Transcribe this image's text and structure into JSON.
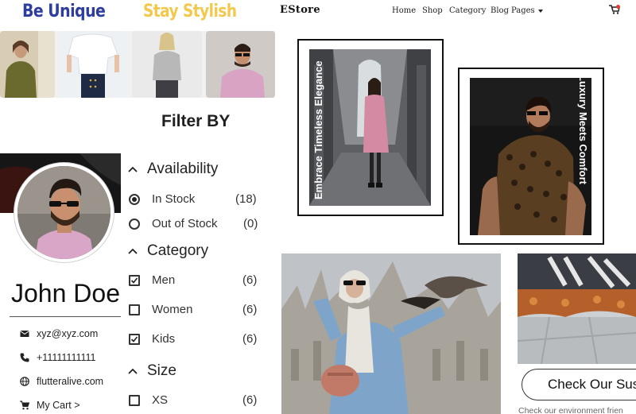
{
  "taglines": {
    "first": "Be Unique",
    "second": "Stay Stylish"
  },
  "header": {
    "brand": "EStore",
    "nav": [
      "Home",
      "Shop",
      "Category",
      "Blog",
      "Pages"
    ]
  },
  "filter": {
    "title": "Filter BY",
    "availability": {
      "title": "Availability",
      "options": [
        {
          "label": "In Stock",
          "count": "(18)",
          "selected": true
        },
        {
          "label": "Out of Stock",
          "count": "(0)",
          "selected": false
        }
      ]
    },
    "category": {
      "title": "Category",
      "options": [
        {
          "label": "Men",
          "count": "(6)",
          "checked": true
        },
        {
          "label": "Women",
          "count": "(6)",
          "checked": false
        },
        {
          "label": "Kids",
          "count": "(6)",
          "checked": true
        }
      ]
    },
    "size": {
      "title": "Size",
      "options": [
        {
          "label": "XS",
          "count": "(6)",
          "checked": false
        }
      ]
    }
  },
  "profile": {
    "name": "John Doe",
    "email": "xyz@xyz.com",
    "phone": "+11111111111",
    "website": "flutteralive.com",
    "cart": "My Cart >"
  },
  "promos": {
    "left_caption": "Embrace Timeless Elegance",
    "right_caption": "Luxury Meets Comfort"
  },
  "cta": {
    "label": "Check Our Sus",
    "sub": "Check our environment frien"
  },
  "colors": {
    "tagline_blue": "#2f3e9e",
    "tagline_yellow": "#f2c94c",
    "cart_badge": "#e53935"
  },
  "icons": [
    "email-icon",
    "phone-icon",
    "globe-icon",
    "cart-icon",
    "chevron-up-icon",
    "chevron-down-icon"
  ]
}
